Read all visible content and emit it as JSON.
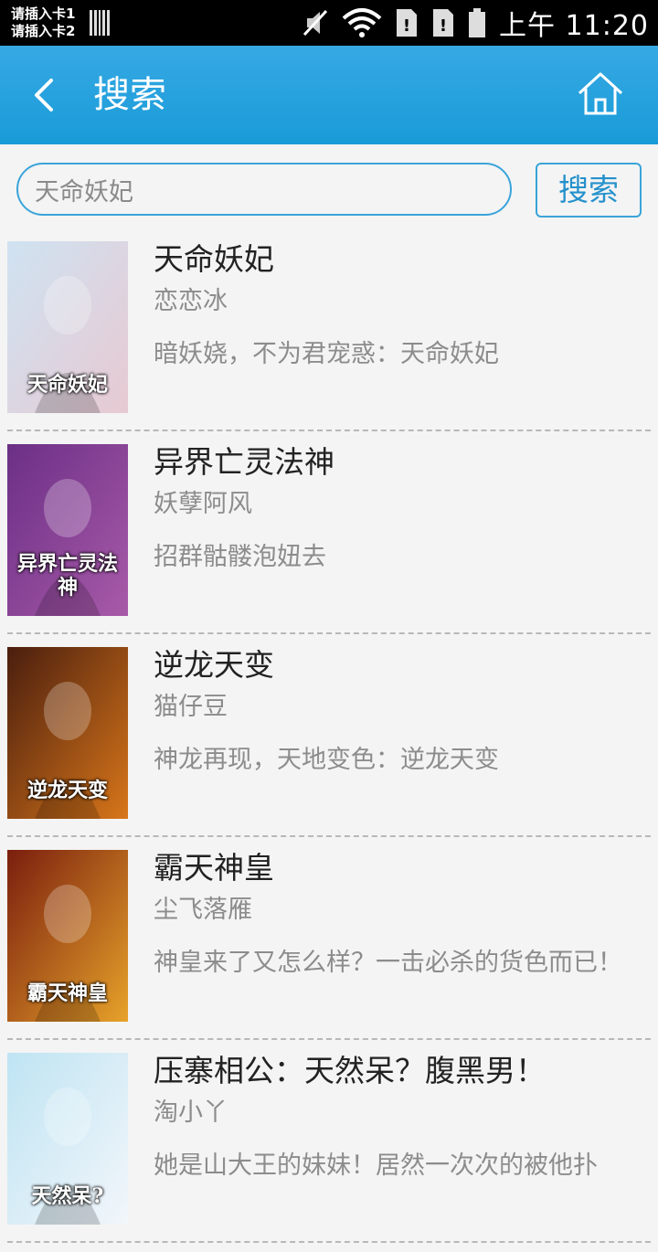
{
  "status_bar": {
    "sim1": "请插入卡1",
    "sim2": "请插入卡2",
    "time": "上午 11:20"
  },
  "header": {
    "title": "搜索",
    "icons": [
      "back-arrow-icon",
      "home-icon"
    ]
  },
  "search": {
    "value": "天命妖妃",
    "button_label": "搜索"
  },
  "results": [
    {
      "title": "天命妖妃",
      "author": "恋恋冰",
      "desc": "暗妖娆，不为君宠惑：天命妖妃",
      "cover_text": "天命妖妃",
      "cover_colors": [
        "#cfe3f2",
        "#e7c9d2"
      ]
    },
    {
      "title": "异界亡灵法神",
      "author": "妖孽阿风",
      "desc": "招群骷髅泡妞去",
      "cover_text": "异界亡灵法神",
      "cover_colors": [
        "#6b2f86",
        "#a85aa8"
      ]
    },
    {
      "title": "逆龙天变",
      "author": "猫仔豆",
      "desc": "神龙再现，天地变色：逆龙天变",
      "cover_text": "逆龙天变",
      "cover_colors": [
        "#4a1e0e",
        "#d8761a"
      ]
    },
    {
      "title": "霸天神皇",
      "author": "尘飞落雁",
      "desc": "神皇来了又怎么样？一击必杀的货色而已！",
      "cover_text": "霸天神皇",
      "cover_colors": [
        "#7a1e0e",
        "#e7a22a"
      ]
    },
    {
      "title": "压寨相公：天然呆？腹黑男！",
      "author": "淘小丫",
      "desc": "她是山大王的妹妹！居然一次次的被他扑",
      "cover_text": "天然呆?",
      "cover_colors": [
        "#bfe4f3",
        "#f2f6fa"
      ]
    }
  ]
}
